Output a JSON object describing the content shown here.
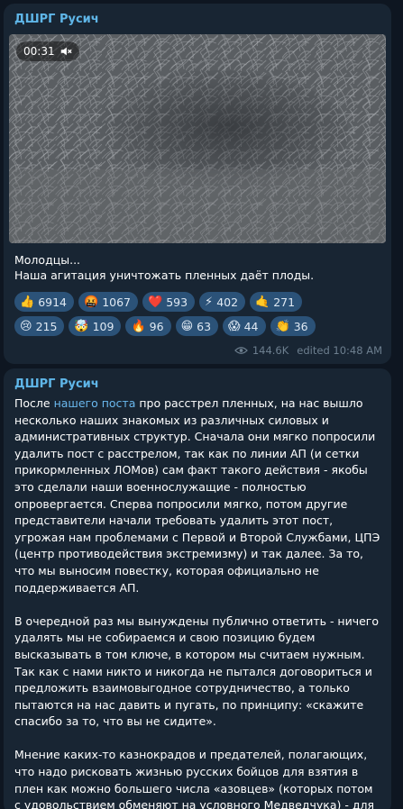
{
  "post1": {
    "sender": "ДШРГ Русич",
    "video": {
      "duration": "00:31",
      "mute_icon": "speaker-muted-icon"
    },
    "caption_line1": "Молодцы...",
    "caption_line2": "Наша агитация уничтожать пленных даёт плоды.",
    "reactions": [
      {
        "emoji": "👍",
        "count": "6914"
      },
      {
        "emoji": "🤬",
        "count": "1067"
      },
      {
        "emoji": "❤️",
        "count": "593"
      },
      {
        "emoji": "⚡",
        "count": "402"
      },
      {
        "emoji": "🤙",
        "count": "271"
      },
      {
        "emoji": "😢",
        "count": "215"
      },
      {
        "emoji": "🤯",
        "count": "109"
      },
      {
        "emoji": "🔥",
        "count": "96"
      },
      {
        "emoji": "😁",
        "count": "63"
      },
      {
        "emoji": "😱",
        "count": "44"
      },
      {
        "emoji": "👏",
        "count": "36"
      }
    ],
    "views": "144.6K",
    "edited": "edited 10:48 AM"
  },
  "post2": {
    "sender": "ДШРГ Русич",
    "p1_before": "После ",
    "p1_link": "нашего поста",
    "p1_after": " про расстрел пленных, на нас вышло несколько наших знакомых из различных силовых и административных структур. Сначала они мягко попросили удалить пост с расстрелом, так как по линии АП (и сетки прикормленных ЛОМов) сам факт такого действия - якобы это сделали наши военнослужащие - полностью опровергается. Сперва попросили мягко, потом другие представители начали требовать удалить этот пост, угрожая нам проблемами с Первой и Второй Службами, ЦПЭ (центр противодействия экстремизму) и так далее. За то, что мы выносим повестку, которая официально не поддерживается АП.",
    "p2": "В очередной раз мы вынуждены публично ответить - ничего удалять мы не собираемся и свою позицию будем высказывать в том ключе, в котором мы считаем нужным. Так как с нами никто и никогда не пытался договориться и предложить взаимовыгодное сотрудничество, а только пытаются на нас давить и пугать, по принципу: «скажите спасибо за то, что вы не сидите».",
    "p3": "Мнение каких-то казнокрадов и предателей, полагающих, что надо рисковать жизнью русских бойцов для взятия в плен как можно большего числа «азовцев» (которых потом с удовольствием обменяют на условного Медведчука) - для нас не является и не будет являться достойным внимания."
  }
}
